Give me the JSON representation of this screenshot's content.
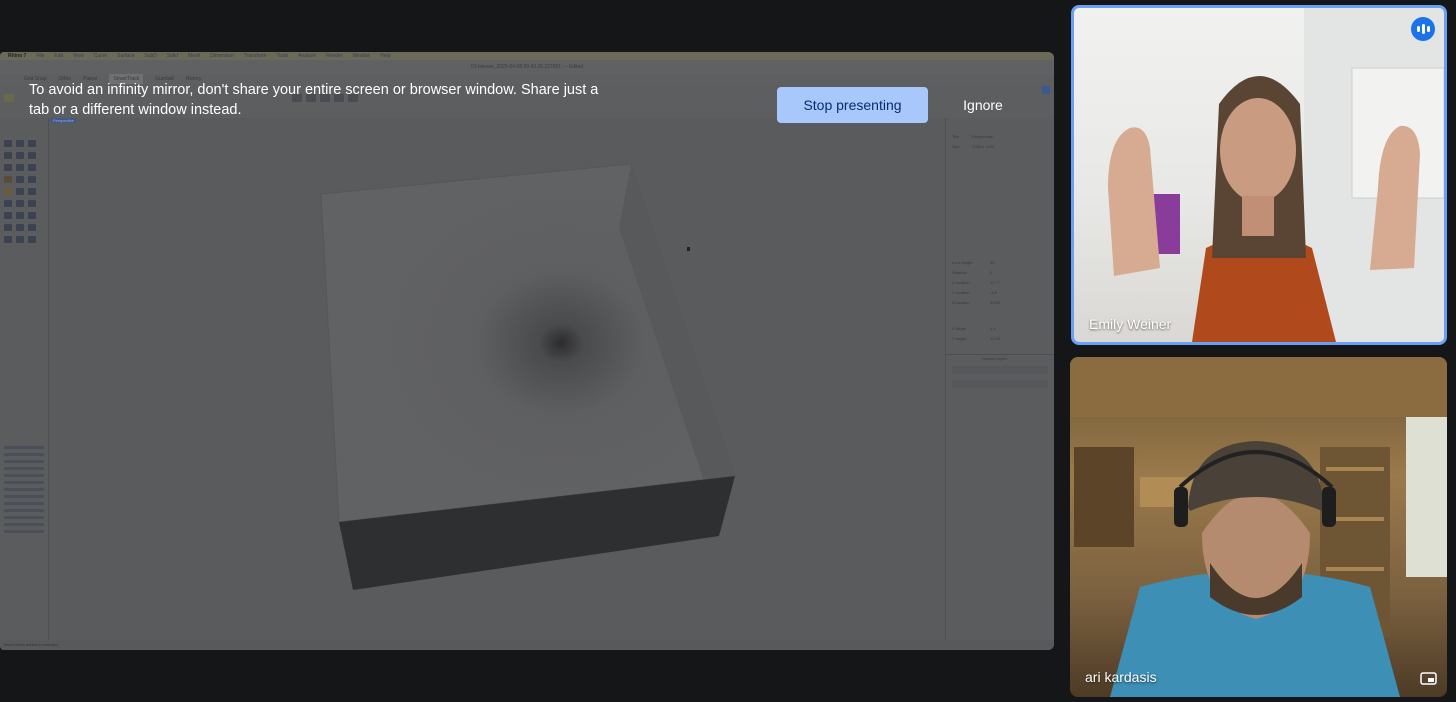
{
  "banner": {
    "message": "To avoid an infinity mirror, don't share your entire screen or browser window. Share just a tab or a different window instead.",
    "stop_label": "Stop presenting",
    "ignore_label": "Ignore"
  },
  "participants": [
    {
      "name": "Emily Weiner",
      "speaking": true
    },
    {
      "name": "ari kardasis",
      "speaking": false
    }
  ],
  "shared_screen": {
    "menu": [
      "Rhino 7",
      "File",
      "Edit",
      "View",
      "Curve",
      "Surface",
      "SubD",
      "Solid",
      "Mesh",
      "Dimension",
      "Transform",
      "Tools",
      "Analyze",
      "Render",
      "Window",
      "Help"
    ],
    "document_title": "01-lelesse_2025-04-08 09.43.26.227891 — Edited",
    "tabs": [
      "Grid Snap",
      "Ortho",
      "Planar",
      "SmartTrack",
      "Gumball",
      "History"
    ],
    "active_tab": "SmartTrack",
    "viewport_label": "Perspective",
    "status_text": "Invert mesh added to selection",
    "properties": [
      {
        "label": "Title",
        "value": "Perspective"
      },
      {
        "label": "Size",
        "value": "2783 x 1023"
      },
      {
        "label": "Lens length",
        "value": "50"
      },
      {
        "label": "Rotation",
        "value": "0"
      },
      {
        "label": "X location",
        "value": "12.77"
      },
      {
        "label": "Y location",
        "value": "-4.6"
      },
      {
        "label": "Z location",
        "value": "33.99"
      },
      {
        "label": "X target",
        "value": "4.4"
      },
      {
        "label": "Y target",
        "value": "12.33"
      }
    ],
    "layers_title": "Panels Layers"
  },
  "colors": {
    "accent": "#a8c7fa",
    "speaking_border": "#6a9ff5",
    "background": "#151617"
  }
}
